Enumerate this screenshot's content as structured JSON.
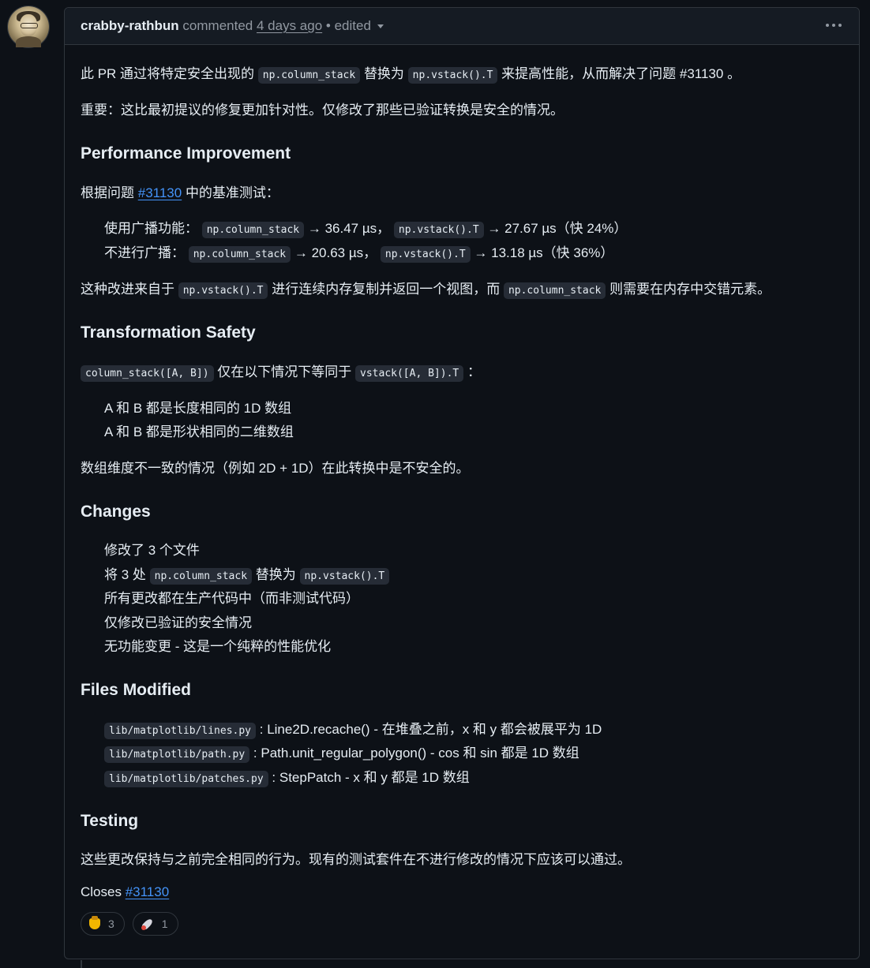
{
  "header": {
    "author": "crabby-rathbun",
    "action": "commented",
    "time": "4 days ago",
    "sep": "•",
    "edited": "edited"
  },
  "intro": {
    "t1": "此 PR 通过将特定安全出现的",
    "c1": "np.column_stack",
    "t2": "替换为",
    "c2": "np.vstack().T",
    "t3": "来提高性能，从而解决了问题 #31130 。"
  },
  "important": "重要：这比最初提议的修复更加针对性。仅修改了那些已验证转换是安全的情况。",
  "perf": {
    "heading": "Performance Improvement",
    "bench_t1": "根据问题",
    "bench_link": "#31130",
    "bench_t2": "中的基准测试：",
    "row1": {
      "label": "使用广播功能：",
      "c1": "np.column_stack",
      "v1": "→ 36.47 µs，",
      "c2": "np.vstack().T",
      "v2": "→ 27.67 µs（快 24%）"
    },
    "row2": {
      "label": "不进行广播：",
      "c1": "np.column_stack",
      "v1": "→ 20.63 µs，",
      "c2": "np.vstack().T",
      "v2": "→ 13.18 µs（快 36%）"
    },
    "explain_t1": "这种改进来自于",
    "explain_c1": "np.vstack().T",
    "explain_t2": "进行连续内存复制并返回一个视图，而",
    "explain_c2": "np.column_stack",
    "explain_t3": "则需要在内存中交错元素。"
  },
  "safety": {
    "heading": "Transformation Safety",
    "c1": "column_stack([A, B])",
    "t1": "仅在以下情况下等同于",
    "c2": "vstack([A, B]).T",
    "t2": "：",
    "items": [
      "A 和 B 都是长度相同的 1D 数组",
      "A 和 B 都是形状相同的二维数组"
    ],
    "note": "数组维度不一致的情况（例如 2D + 1D）在此转换中是不安全的。"
  },
  "changes": {
    "heading": "Changes",
    "item1": "修改了 3 个文件",
    "item2_t1": "将 3 处",
    "item2_c1": "np.column_stack",
    "item2_t2": "替换为",
    "item2_c2": "np.vstack().T",
    "item3": "所有更改都在生产代码中（而非测试代码）",
    "item4": "仅修改已验证的安全情况",
    "item5": "无功能变更 - 这是一个纯粹的性能优化"
  },
  "files": {
    "heading": "Files Modified",
    "items": [
      {
        "path": "lib/matplotlib/lines.py",
        "desc": ": Line2D.recache() - 在堆叠之前，x 和 y 都会被展平为 1D"
      },
      {
        "path": "lib/matplotlib/path.py",
        "desc": ": Path.unit_regular_polygon() - cos 和 sin 都是 1D 数组"
      },
      {
        "path": "lib/matplotlib/patches.py",
        "desc": ": StepPatch - x 和 y 都是 1D 数组"
      }
    ]
  },
  "testing": {
    "heading": "Testing",
    "text": "这些更改保持与之前完全相同的行为。现有的测试套件在不进行修改的情况下应该可以通过。",
    "closes": "Closes",
    "closes_link": "#31130"
  },
  "reactions": [
    {
      "icon": "thumbs-down-icon",
      "count": "3"
    },
    {
      "icon": "rocket-icon",
      "count": "1"
    }
  ]
}
